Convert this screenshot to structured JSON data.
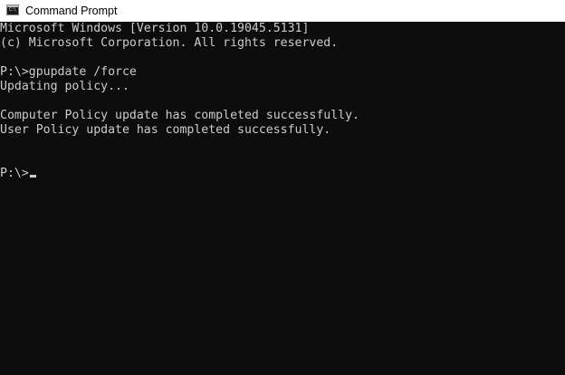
{
  "window": {
    "title": "Command Prompt",
    "icon": "cmd-icon"
  },
  "console": {
    "lines": [
      "Microsoft Windows [Version 10.0.19045.5131]",
      "(c) Microsoft Corporation. All rights reserved.",
      "",
      "P:\\>gpupdate /force",
      "Updating policy...",
      "",
      "Computer Policy update has completed successfully.",
      "User Policy update has completed successfully.",
      "",
      "",
      "P:\\>"
    ],
    "cursor": "block-underline",
    "colors": {
      "background": "#0c0c0c",
      "text": "#cccccc",
      "titlebar": "#ffffff"
    }
  }
}
